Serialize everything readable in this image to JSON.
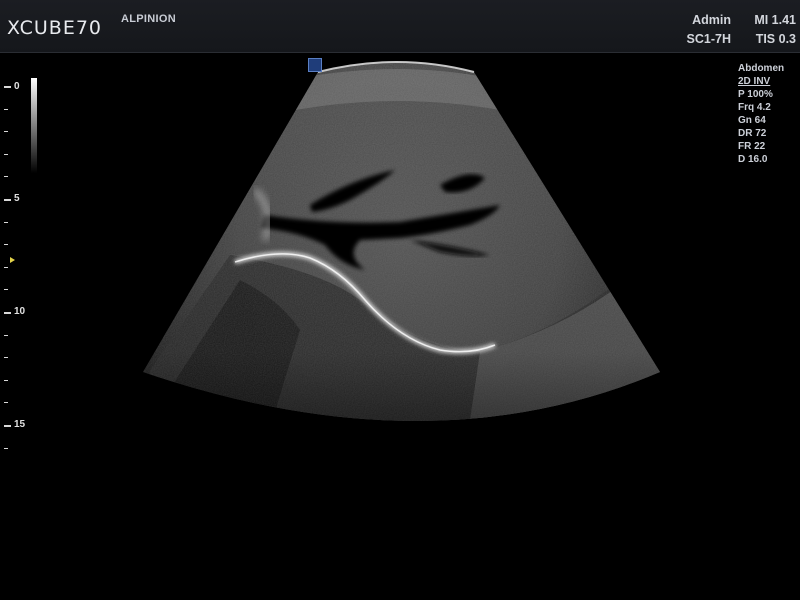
{
  "header": {
    "product": "XCUBE70",
    "hospital": "ALPINION",
    "user": "Admin",
    "probe": "SC1-7H",
    "mi": "MI 1.41",
    "tis": "TIS 0.3"
  },
  "ruler": {
    "labels": [
      "0",
      "5",
      "10",
      "15"
    ]
  },
  "params": {
    "preset": "Abdomen",
    "mode": "2D INV",
    "power": "P 100%",
    "frequency": "Frq 4.2",
    "gain": "Gn 64",
    "dynamic_range": "DR 72",
    "frame_rate": "FR 22",
    "depth": "D 16.0"
  },
  "colors": {
    "header_bg": "#181a1e",
    "focus_marker": "#e3d34a",
    "orientation_marker": "#1f3d7a"
  }
}
